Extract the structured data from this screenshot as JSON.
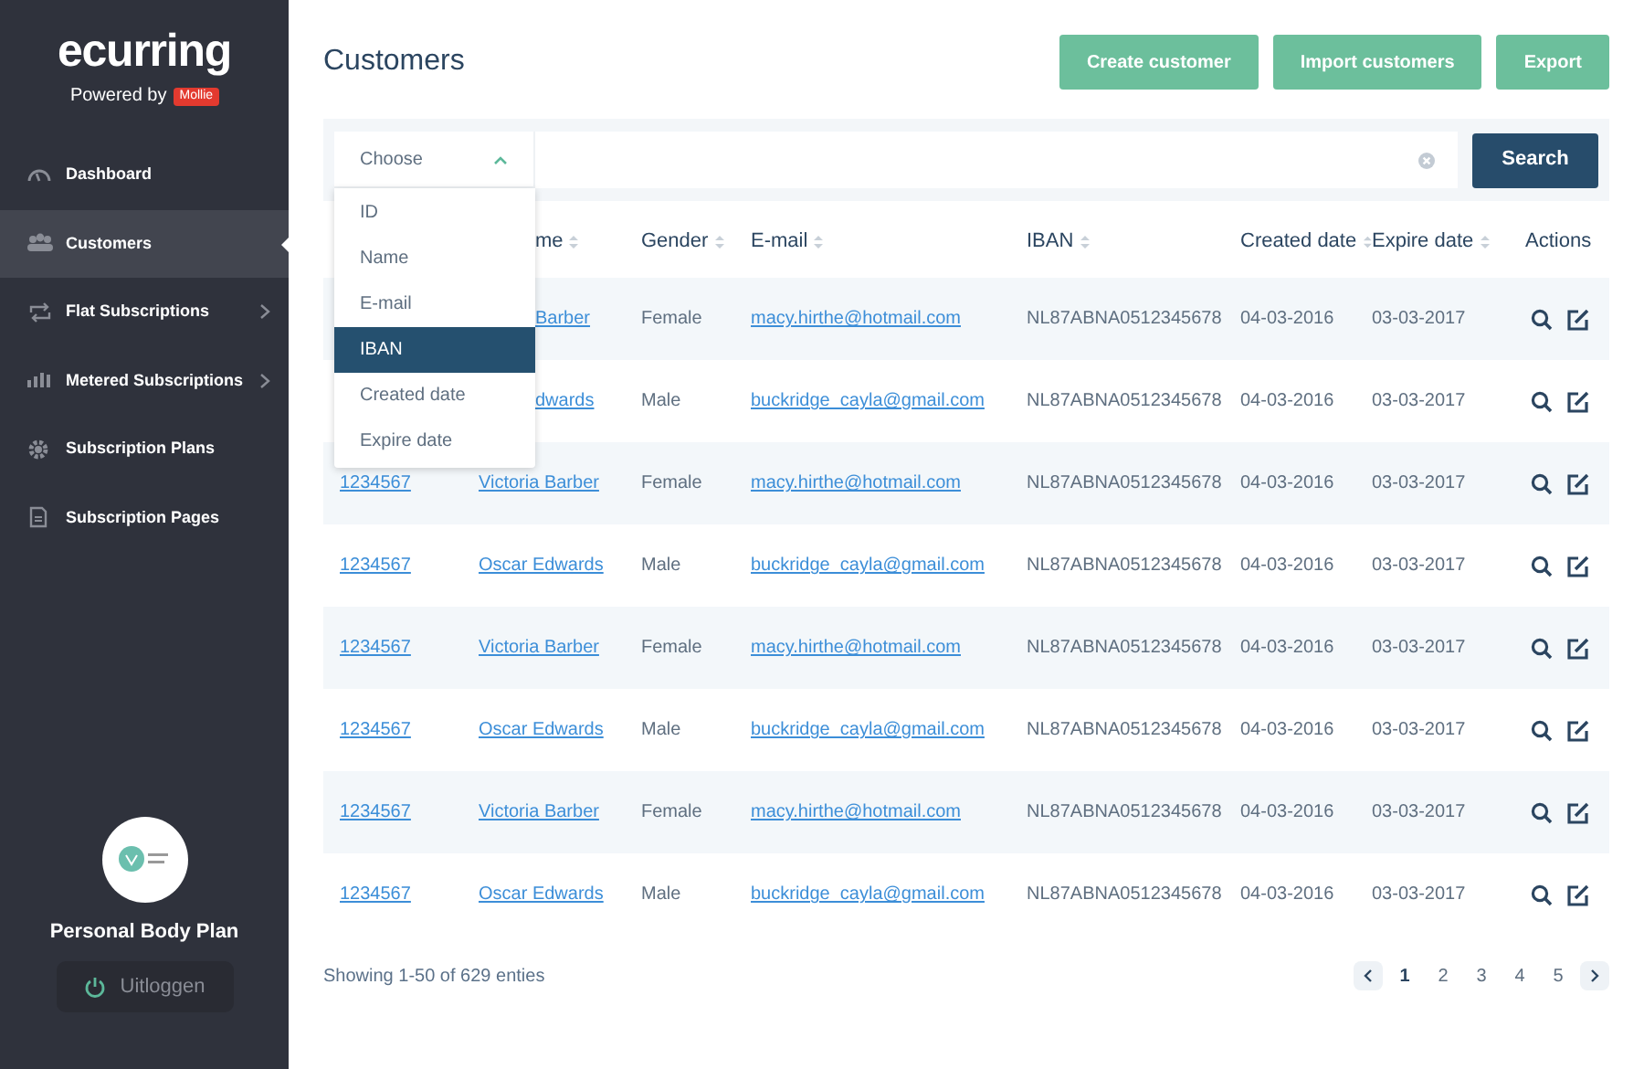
{
  "sidebar": {
    "logo": "ecurring",
    "powered_by": "Powered by",
    "partner_badge": "Mollie",
    "items": [
      {
        "label": "Dashboard",
        "selected": false,
        "submenu": false
      },
      {
        "label": "Customers",
        "selected": true,
        "submenu": false
      },
      {
        "label": "Flat Subscriptions",
        "selected": false,
        "submenu": true
      },
      {
        "label": "Metered Subscriptions",
        "selected": false,
        "submenu": true
      },
      {
        "label": "Subscription Plans",
        "selected": false,
        "submenu": false
      },
      {
        "label": "Subscription Pages",
        "selected": false,
        "submenu": false
      }
    ],
    "account": {
      "name": "Personal Body Plan",
      "logout": "Uitloggen"
    }
  },
  "header": {
    "title": "Customers",
    "buttons": [
      "Create customer",
      "Import customers",
      "Export"
    ]
  },
  "search": {
    "dropdown": {
      "value": "Choose",
      "expanded": true,
      "options": [
        {
          "label": "ID",
          "selected": false
        },
        {
          "label": "Name",
          "selected": false
        },
        {
          "label": "E-mail",
          "selected": false
        },
        {
          "label": "IBAN",
          "selected": true
        },
        {
          "label": "Created date",
          "selected": false
        },
        {
          "label": "Expire date",
          "selected": false
        }
      ]
    },
    "button": "Search"
  },
  "table": {
    "columns": [
      {
        "label": "me",
        "sortable": true
      },
      {
        "label": "Gender",
        "sortable": true
      },
      {
        "label": "E-mail",
        "sortable": true
      },
      {
        "label": "IBAN",
        "sortable": true
      },
      {
        "label": "Created date",
        "sortable": true
      },
      {
        "label": "Expire date",
        "sortable": true
      },
      {
        "label": "Actions",
        "sortable": false
      }
    ],
    "rows": [
      {
        "name": "Barber",
        "name_clipped": true,
        "gender": "Female",
        "email": "macy.hirthe@hotmail.com",
        "iban": "NL87ABNA0512345678",
        "created": "04-03-2016",
        "expires": "03-03-2017"
      },
      {
        "name": "dwards",
        "name_clipped": true,
        "gender": "Male",
        "email": "buckridge_cayla@gmail.com",
        "iban": "NL87ABNA0512345678",
        "created": "04-03-2016",
        "expires": "03-03-2017"
      },
      {
        "id": "1234567",
        "name": "Victoria Barber",
        "name_clipped": false,
        "gender": "Female",
        "email": "macy.hirthe@hotmail.com",
        "iban": "NL87ABNA0512345678",
        "created": "04-03-2016",
        "expires": "03-03-2017"
      },
      {
        "id": "1234567",
        "name": "Oscar Edwards",
        "name_clipped": false,
        "gender": "Male",
        "email": "buckridge_cayla@gmail.com",
        "iban": "NL87ABNA0512345678",
        "created": "04-03-2016",
        "expires": "03-03-2017"
      },
      {
        "id": "1234567",
        "name": "Victoria Barber",
        "name_clipped": false,
        "gender": "Female",
        "email": "macy.hirthe@hotmail.com",
        "iban": "NL87ABNA0512345678",
        "created": "04-03-2016",
        "expires": "03-03-2017"
      },
      {
        "id": "1234567",
        "name": "Oscar Edwards",
        "name_clipped": false,
        "gender": "Male",
        "email": "buckridge_cayla@gmail.com",
        "iban": "NL87ABNA0512345678",
        "created": "04-03-2016",
        "expires": "03-03-2017"
      },
      {
        "id": "1234567",
        "name": "Victoria Barber",
        "name_clipped": false,
        "gender": "Female",
        "email": "macy.hirthe@hotmail.com",
        "iban": "NL87ABNA0512345678",
        "created": "04-03-2016",
        "expires": "03-03-2017"
      },
      {
        "id": "1234567",
        "name": "Oscar Edwards",
        "name_clipped": false,
        "gender": "Male",
        "email": "buckridge_cayla@gmail.com",
        "iban": "NL87ABNA0512345678",
        "created": "04-03-2016",
        "expires": "03-03-2017"
      }
    ]
  },
  "footer": {
    "summary": "Showing 1-50 of 629 enties",
    "pages": [
      {
        "label": "1",
        "selected": true
      },
      {
        "label": "2",
        "selected": false
      },
      {
        "label": "3",
        "selected": false
      },
      {
        "label": "4",
        "selected": false
      },
      {
        "label": "5",
        "selected": false
      }
    ]
  }
}
